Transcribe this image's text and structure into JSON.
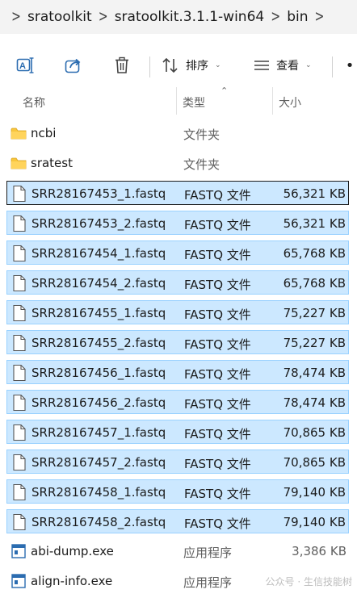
{
  "breadcrumb": [
    "sratoolkit",
    "sratoolkit.3.1.1-win64",
    "bin"
  ],
  "toolbar": {
    "sort_label": "排序",
    "view_label": "查看"
  },
  "columns": {
    "name": "名称",
    "type": "类型",
    "size": "大小"
  },
  "files": [
    {
      "name": "ncbi",
      "type": "文件夹",
      "size": "",
      "icon": "folder-icon",
      "selected": false
    },
    {
      "name": "sratest",
      "type": "文件夹",
      "size": "",
      "icon": "folder-icon",
      "selected": false
    },
    {
      "name": "SRR28167453_1.fastq",
      "type": "FASTQ 文件",
      "size": "56,321 KB",
      "icon": "file-icon",
      "selected": true,
      "focused": true
    },
    {
      "name": "SRR28167453_2.fastq",
      "type": "FASTQ 文件",
      "size": "56,321 KB",
      "icon": "file-icon",
      "selected": true
    },
    {
      "name": "SRR28167454_1.fastq",
      "type": "FASTQ 文件",
      "size": "65,768 KB",
      "icon": "file-icon",
      "selected": true
    },
    {
      "name": "SRR28167454_2.fastq",
      "type": "FASTQ 文件",
      "size": "65,768 KB",
      "icon": "file-icon",
      "selected": true
    },
    {
      "name": "SRR28167455_1.fastq",
      "type": "FASTQ 文件",
      "size": "75,227 KB",
      "icon": "file-icon",
      "selected": true
    },
    {
      "name": "SRR28167455_2.fastq",
      "type": "FASTQ 文件",
      "size": "75,227 KB",
      "icon": "file-icon",
      "selected": true
    },
    {
      "name": "SRR28167456_1.fastq",
      "type": "FASTQ 文件",
      "size": "78,474 KB",
      "icon": "file-icon",
      "selected": true
    },
    {
      "name": "SRR28167456_2.fastq",
      "type": "FASTQ 文件",
      "size": "78,474 KB",
      "icon": "file-icon",
      "selected": true
    },
    {
      "name": "SRR28167457_1.fastq",
      "type": "FASTQ 文件",
      "size": "70,865 KB",
      "icon": "file-icon",
      "selected": true
    },
    {
      "name": "SRR28167457_2.fastq",
      "type": "FASTQ 文件",
      "size": "70,865 KB",
      "icon": "file-icon",
      "selected": true
    },
    {
      "name": "SRR28167458_1.fastq",
      "type": "FASTQ 文件",
      "size": "79,140 KB",
      "icon": "file-icon",
      "selected": true
    },
    {
      "name": "SRR28167458_2.fastq",
      "type": "FASTQ 文件",
      "size": "79,140 KB",
      "icon": "file-icon",
      "selected": true
    },
    {
      "name": "abi-dump.exe",
      "type": "应用程序",
      "size": "3,386 KB",
      "icon": "exe-icon",
      "selected": false
    },
    {
      "name": "align-info.exe",
      "type": "应用程序",
      "size": "",
      "icon": "exe-icon",
      "selected": false
    }
  ],
  "watermark": "公众号 · 生信技能树",
  "colors": {
    "selection_bg": "#cce8ff",
    "selection_border": "#99d1ff",
    "folder": "#f8c63d",
    "exe": "#2b6cb0"
  }
}
